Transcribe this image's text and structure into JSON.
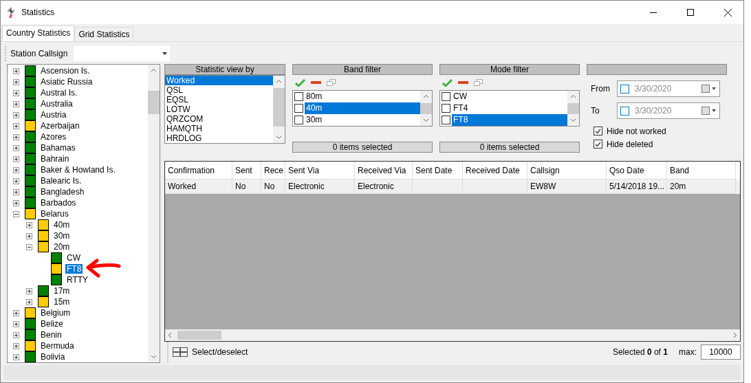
{
  "window": {
    "title": "Statistics"
  },
  "tabs": [
    {
      "label": "Country Statistics",
      "selected": true
    },
    {
      "label": "Grid Statistics",
      "selected": false
    }
  ],
  "toolbar": {
    "label": "Station Callsign"
  },
  "tree": [
    {
      "label": "Ascension Is.",
      "color": "#008000",
      "expanded": false,
      "selected": false
    },
    {
      "label": "Asiatic Russia",
      "color": "#008000",
      "expanded": false,
      "selected": false
    },
    {
      "label": "Austral Is.",
      "color": "#008000",
      "expanded": false,
      "selected": false
    },
    {
      "label": "Australia",
      "color": "#008000",
      "expanded": false,
      "selected": false
    },
    {
      "label": "Austria",
      "color": "#008000",
      "expanded": false,
      "selected": false
    },
    {
      "label": "Azerbaijan",
      "color": "#ffcc00",
      "expanded": false,
      "selected": false
    },
    {
      "label": "Azores",
      "color": "#008000",
      "expanded": false,
      "selected": false
    },
    {
      "label": "Bahamas",
      "color": "#008000",
      "expanded": false,
      "selected": false
    },
    {
      "label": "Bahrain",
      "color": "#008000",
      "expanded": false,
      "selected": false
    },
    {
      "label": "Baker & Howland Is.",
      "color": "#008000",
      "expanded": false,
      "selected": false
    },
    {
      "label": "Balearic Is.",
      "color": "#008000",
      "expanded": false,
      "selected": false
    },
    {
      "label": "Bangladesh",
      "color": "#008000",
      "expanded": false,
      "selected": false
    },
    {
      "label": "Barbados",
      "color": "#008000",
      "expanded": false,
      "selected": false
    },
    {
      "label": "Belarus",
      "color": "#ffcc00",
      "expanded": true,
      "selected": false,
      "children": [
        {
          "label": "40m",
          "color": "#ffcc00",
          "expanded": false,
          "selected": false
        },
        {
          "label": "30m",
          "color": "#ffcc00",
          "expanded": false,
          "selected": false
        },
        {
          "label": "20m",
          "color": "#ffcc00",
          "expanded": true,
          "selected": false,
          "children": [
            {
              "label": "CW",
              "color": "#008000",
              "selected": false
            },
            {
              "label": "FT8",
              "color": "#ffcc00",
              "selected": true
            },
            {
              "label": "RTTY",
              "color": "#008000",
              "selected": false
            }
          ]
        },
        {
          "label": "17m",
          "color": "#008000",
          "expanded": false,
          "selected": false
        },
        {
          "label": "15m",
          "color": "#ffcc00",
          "expanded": false,
          "selected": false
        }
      ]
    },
    {
      "label": "Belgium",
      "color": "#ffcc00",
      "expanded": false,
      "selected": false
    },
    {
      "label": "Belize",
      "color": "#008000",
      "expanded": false,
      "selected": false
    },
    {
      "label": "Benin",
      "color": "#008000",
      "expanded": false,
      "selected": false
    },
    {
      "label": "Bermuda",
      "color": "#ffcc00",
      "expanded": false,
      "selected": false
    },
    {
      "label": "Bolivia",
      "color": "#008000",
      "expanded": false,
      "selected": false
    }
  ],
  "statistic_view": {
    "title": "Statistic view by",
    "items": [
      {
        "label": "Worked",
        "selected": true
      },
      {
        "label": "QSL",
        "selected": false
      },
      {
        "label": "EQSL",
        "selected": false
      },
      {
        "label": "LOTW",
        "selected": false
      },
      {
        "label": "QRZCOM",
        "selected": false
      },
      {
        "label": "HAMQTH",
        "selected": false
      },
      {
        "label": "HRDLOG",
        "selected": false
      }
    ]
  },
  "filters": [
    {
      "title": "Band filter",
      "items": [
        {
          "label": "80m",
          "checked": false,
          "selected": false
        },
        {
          "label": "40m",
          "checked": false,
          "selected": true
        },
        {
          "label": "30m",
          "checked": false,
          "selected": false
        }
      ],
      "summary": "0 items selected"
    },
    {
      "title": "Mode filter",
      "items": [
        {
          "label": "CW",
          "checked": false,
          "selected": false
        },
        {
          "label": "FT4",
          "checked": false,
          "selected": false
        },
        {
          "label": "FT8",
          "checked": false,
          "selected": true
        }
      ],
      "summary": "0 items selected"
    }
  ],
  "dates": [
    {
      "label": "From",
      "value": "3/30/2020",
      "checked": false
    },
    {
      "label": "To",
      "value": "3/30/2020",
      "checked": false
    }
  ],
  "options": [
    {
      "label": "Hide not worked",
      "checked": true
    },
    {
      "label": "Hide deleted",
      "checked": true
    }
  ],
  "table": {
    "columns": [
      "Confirmation",
      "Sent",
      "Rece",
      "Sent Via",
      "Received Via",
      "Sent Date",
      "Received Date",
      "Callsign",
      "Qso Date",
      "Band"
    ],
    "rows": [
      [
        "Worked",
        "No",
        "No",
        "Electronic",
        "Electronic",
        "",
        "",
        "EW8W",
        "5/14/2018 19...",
        "20m"
      ]
    ]
  },
  "footer": {
    "select_label": "Select/deselect",
    "selected_text": "Selected **0** of **1**",
    "max_label": "max:",
    "max_value": "10000"
  }
}
